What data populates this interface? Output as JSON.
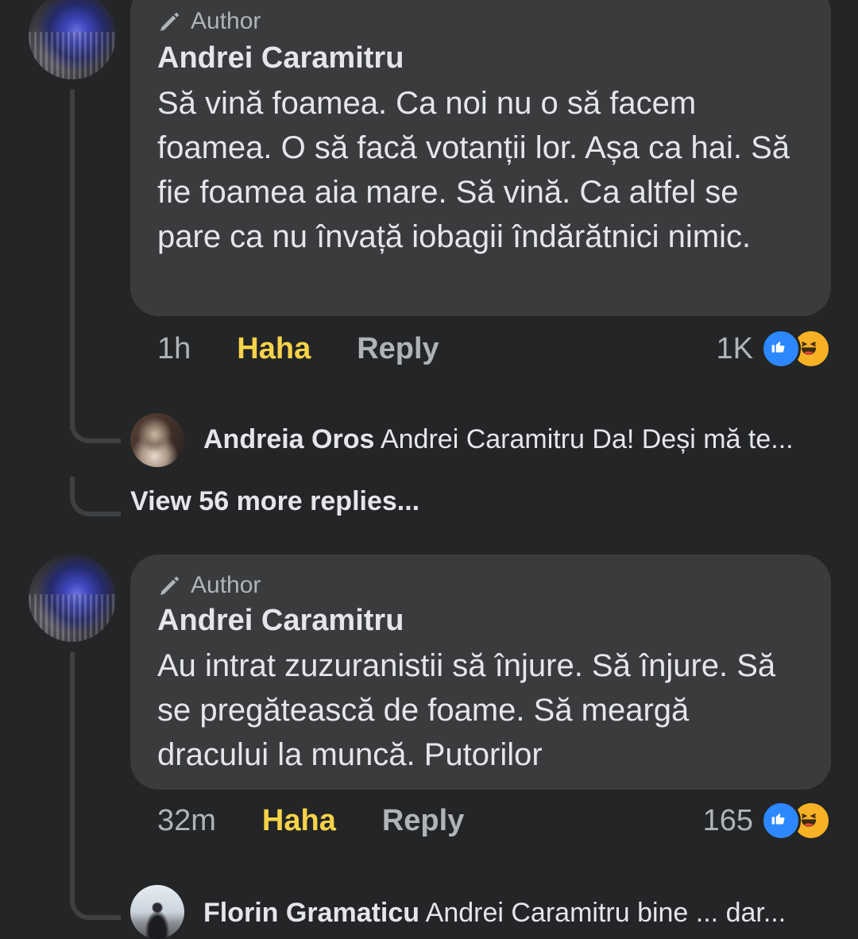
{
  "comments": [
    {
      "author_badge": "Author",
      "name": "Andrei Caramitru",
      "text": "Să vină foamea. Ca noi nu o să facem foamea. O să facă votanții lor. Așa ca hai. Să fie foamea aia mare. Să vină. Ca altfel se pare ca nu învață iobagii îndărătnici nimic.",
      "time": "1h",
      "haha_label": "Haha",
      "reply_label": "Reply",
      "reaction_count": "1K",
      "reply_preview": {
        "name": "Andreia Oros",
        "text": "Andrei Caramitru Da! Deși mă te..."
      },
      "view_more": "View 56 more replies..."
    },
    {
      "author_badge": "Author",
      "name": "Andrei Caramitru",
      "text": "Au intrat zuzuranistii să înjure. Să înjure. Să se pregătească de foame. Să meargă dracului la muncă. Putorilor",
      "time": "32m",
      "haha_label": "Haha",
      "reply_label": "Reply",
      "reaction_count": "165",
      "reply_preview": {
        "name": "Florin Gramaticu",
        "text": "Andrei Caramitru bine ... dar..."
      }
    }
  ],
  "icons": {
    "badge": "pencil-icon",
    "like": "like-icon",
    "haha": "haha-icon"
  },
  "colors": {
    "background": "#242526",
    "bubble": "#3a3b3c",
    "haha_active": "#f7d34a",
    "like_blue": "#2d88ff",
    "haha_yellow": "#f7b125"
  }
}
